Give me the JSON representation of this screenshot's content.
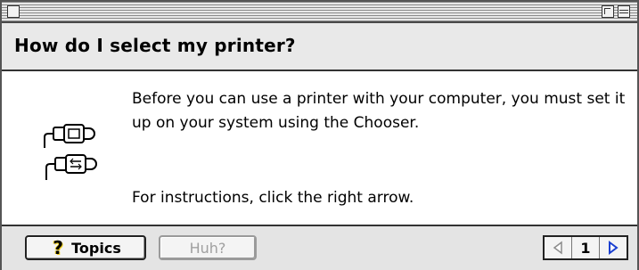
{
  "window": {
    "question": "How do I select my printer?"
  },
  "content": {
    "paragraph1": "Before you can use a printer with your computer, you must set it up on your system using the Chooser.",
    "paragraph2": "For instructions, click the right arrow."
  },
  "footer": {
    "topics_label": "Topics",
    "huh_label": "Huh?",
    "page_number": "1"
  },
  "icons": {
    "topics": "question-mark-icon",
    "illustration": "printer-cables-icon",
    "prev": "left-arrow-icon",
    "next": "right-arrow-icon"
  },
  "colors": {
    "accent": "#1a3fd0",
    "question_mark_yellow": "#f0d020",
    "disabled_text": "#a0a0a0"
  }
}
